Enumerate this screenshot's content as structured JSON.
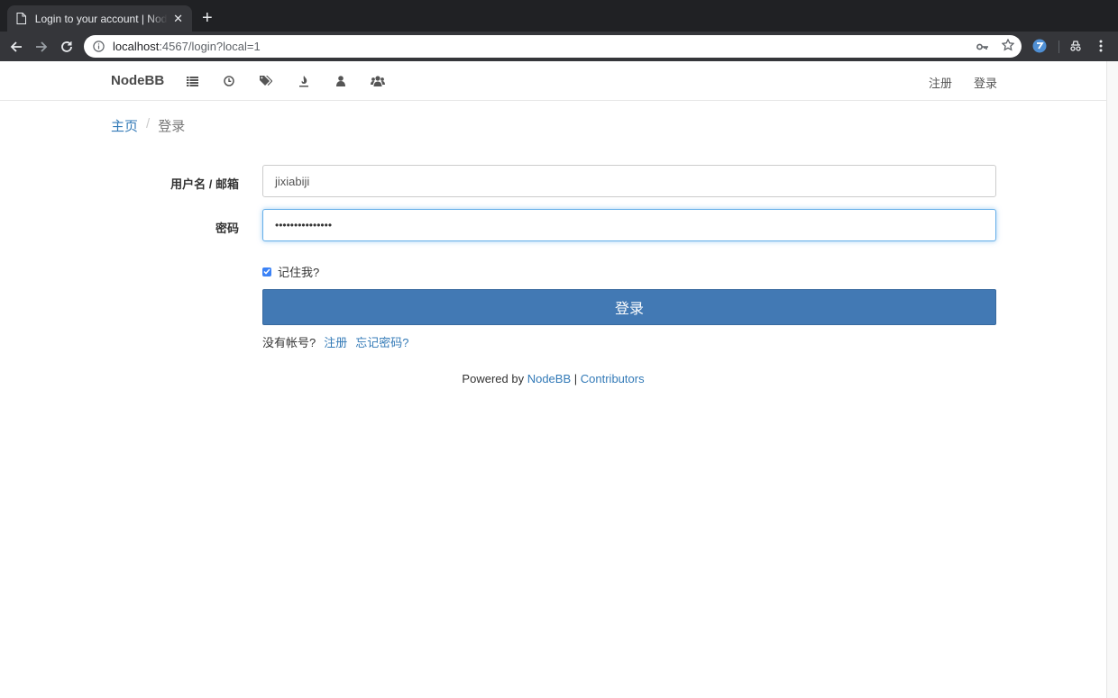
{
  "browser": {
    "tab_title": "Login to your account | NodeBB",
    "url_host": "localhost",
    "url_rest": ":4567/login?local=1"
  },
  "navbar": {
    "brand": "NodeBB",
    "icons": [
      "categories-icon",
      "recent-icon",
      "tags-icon",
      "popular-icon",
      "users-icon",
      "groups-icon"
    ],
    "register_label": "注册",
    "login_label": "登录"
  },
  "breadcrumb": {
    "home": "主页",
    "separator": "/",
    "current": "登录"
  },
  "form": {
    "username_label": "用户名 / 邮箱",
    "username_value": "jixiabiji",
    "password_label": "密码",
    "password_value": "•••••••••••••••",
    "remember_label": "记住我?",
    "remember_checked": true,
    "submit_label": "登录",
    "no_account_text": "没有帐号?",
    "register_link": "注册",
    "forgot_link": "忘记密码?"
  },
  "footer": {
    "powered_by": "Powered by",
    "nodebb_link": "NodeBB",
    "divider": "|",
    "contributors_link": "Contributors"
  },
  "colors": {
    "accent": "#337ab7",
    "button": "#4279b4",
    "chrome_dark": "#202124"
  }
}
